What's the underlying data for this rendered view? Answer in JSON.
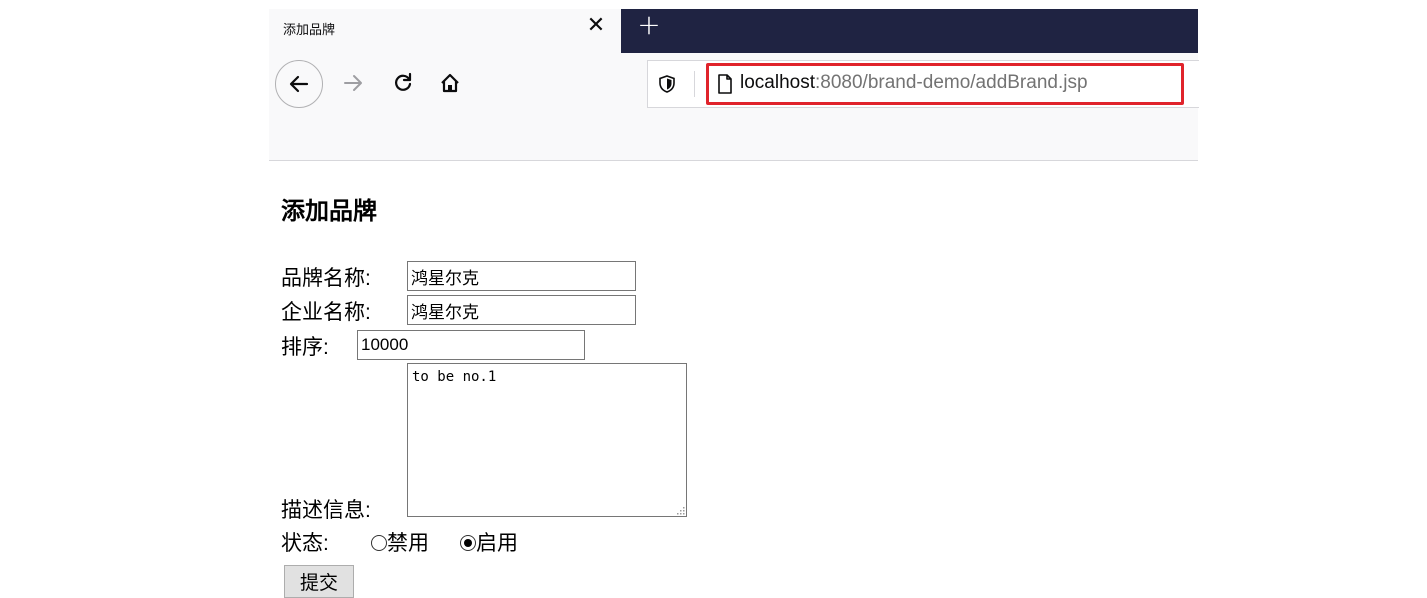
{
  "browser": {
    "tab_title": "添加品牌",
    "tab_close_glyph": "✕",
    "new_tab_glyph": "+",
    "url_host": "localhost",
    "url_path": ":8080/brand-demo/addBrand.jsp",
    "colors": {
      "tabstrip": "#1f2342",
      "toolbar": "#f9f9fa",
      "url_highlight": "#e0232b"
    }
  },
  "page": {
    "heading": "添加品牌",
    "brand_name_label": "品牌名称:",
    "brand_name_value": "鸿星尔克",
    "company_name_label": "企业名称:",
    "company_name_value": "鸿星尔克",
    "ordered_label": "排序:",
    "ordered_value": "10000",
    "description_label": "描述信息:",
    "description_value": "to be no.1",
    "status_label": "状态:",
    "status_options": [
      {
        "label": "禁用",
        "selected": false
      },
      {
        "label": "启用",
        "selected": true
      }
    ],
    "submit_label": "提交"
  }
}
